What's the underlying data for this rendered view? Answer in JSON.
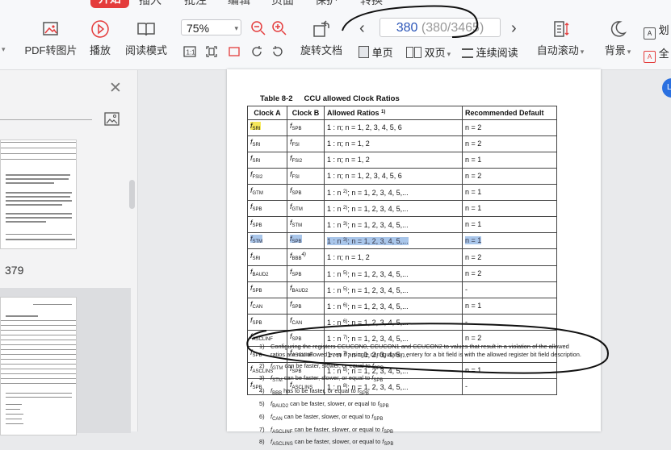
{
  "menu": {
    "tabs": [
      "开始",
      "插入",
      "批注",
      "编辑",
      "页面",
      "保护",
      "转换"
    ]
  },
  "toolbar": {
    "pdf_to_image": "PDF转图片",
    "play": "播放",
    "read_mode": "阅读模式",
    "zoom_value": "75%",
    "rotate": "旋转文档",
    "single_page": "单页",
    "double_page": "双页",
    "continuous": "连续阅读",
    "auto_scroll": "自动滚动",
    "background": "背景",
    "far_right_1": "划",
    "far_right_2": "全"
  },
  "page_nav": {
    "current": "380",
    "total_text": "(380/3465)"
  },
  "sidebar": {
    "thumb_page_label": "379"
  },
  "document": {
    "table_number": "Table 8-2",
    "table_title": "CCU allowed Clock Ratios",
    "headers": {
      "clock_a": "Clock A",
      "clock_b": "Clock B",
      "allowed": "Allowed Ratios",
      "allowed_sup": "1)",
      "recommended": "Recommended Default"
    },
    "rows": [
      {
        "a": "f",
        "as": "SRI",
        "b": "f",
        "bs": "SPB",
        "ratio": "1 : n; n = 1, 2, 3, 4, 5, 6",
        "def": "n = 2"
      },
      {
        "a": "f",
        "as": "SRI",
        "b": "f",
        "bs": "FSI",
        "ratio": "1 : n; n = 1, 2",
        "def": "n = 2"
      },
      {
        "a": "f",
        "as": "SRI",
        "b": "f",
        "bs": "FSI2",
        "ratio": "1 : n; n = 1, 2",
        "def": "n = 1"
      },
      {
        "a": "f",
        "as": "FSI2",
        "b": "f",
        "bs": "FSI",
        "ratio": "1 : n; n = 1, 2, 3, 4, 5, 6",
        "def": "n = 2"
      },
      {
        "a": "f",
        "as": "GTM",
        "b": "f",
        "bs": "SPB",
        "ratio": "1 : n 2); n = 1, 2, 3, 4, 5,...",
        "def": "n = 1"
      },
      {
        "a": "f",
        "as": "SPB",
        "b": "f",
        "bs": "GTM",
        "ratio": "1 : n 2); n = 1, 2, 3, 4, 5,...",
        "def": "n = 1"
      },
      {
        "a": "f",
        "as": "SPB",
        "b": "f",
        "bs": "STM",
        "ratio": "1 : n 3); n = 1, 2, 3, 4, 5,...",
        "def": "n = 1"
      },
      {
        "a": "f",
        "as": "STM",
        "b": "f",
        "bs": "SPB",
        "ratio": "1 : n 3); n = 1, 2, 3, 4, 5,...",
        "def": "n = 1"
      },
      {
        "a": "f",
        "as": "SRI",
        "b": "f",
        "bs": "BBB 4)",
        "ratio": "1 : n; n = 1, 2",
        "def": "n = 2"
      },
      {
        "a": "f",
        "as": "BAUD2",
        "b": "f",
        "bs": "SPB",
        "ratio": "1 : n 5); n = 1, 2, 3, 4, 5,...",
        "def": "n = 2"
      },
      {
        "a": "f",
        "as": "SPB",
        "b": "f",
        "bs": "BAUD2",
        "ratio": "1 : n 5); n = 1, 2, 3, 4, 5,...",
        "def": "-"
      },
      {
        "a": "f",
        "as": "CAN",
        "b": "f",
        "bs": "SPB",
        "ratio": "1 : n 6); n = 1, 2, 3, 4, 5,...",
        "def": "n = 1"
      },
      {
        "a": "f",
        "as": "SPB",
        "b": "f",
        "bs": "CAN",
        "ratio": "1 : n 6); n = 1, 2, 3, 4, 5,...",
        "def": "-"
      },
      {
        "a": "f",
        "as": "ASCLINF",
        "b": "f",
        "bs": "SPB",
        "ratio": "1 : n 7); n = 1, 2, 3, 4, 5,...",
        "def": "n = 2"
      },
      {
        "a": "f",
        "as": "SPB",
        "b": "f",
        "bs": "ASCLINF",
        "ratio": "1 : n 7); n = 1, 2, 3, 4, 5,...",
        "def": "-"
      },
      {
        "a": "f",
        "as": "ASCLINS",
        "b": "f",
        "bs": "SPB",
        "ratio": "1 : n 8); n = 1, 2, 3, 4, 5,...",
        "def": "n = 1"
      },
      {
        "a": "f",
        "as": "SPB",
        "b": "f",
        "bs": "ASCLINS",
        "ratio": "1 : n 8); n = 1, 2, 3, 4, 5,...",
        "def": "-"
      }
    ],
    "footnotes": [
      "Configuring the registers CCUCON0, CCUCON1 and CCUCON2 to values that result in a violation of the allowed ratios are not allowed even if a single configuration entery for a bit field is with the allowed register bit field description.",
      "can be faster, slower, or equal to",
      "can be faster, slower, or equal to",
      "has to be faster, or equal to",
      "can be faster, slower, or equal to",
      "can be faster, slower, or equal to",
      "can be faster, slower, or equal to",
      "can be faster, slower, or equal to"
    ],
    "footnote_subs": [
      "",
      "GTM",
      "STM",
      "BBB",
      "BAUD2",
      "CAN",
      "ASCLINF",
      "ASCLINS"
    ],
    "footnote_targets": [
      "",
      "SPB",
      "SPB",
      "SPB",
      "SPB",
      "SPB",
      "SPB",
      "SPB"
    ]
  },
  "colors": {
    "accent_red": "#e43c3c",
    "page_number_blue": "#2b55b8",
    "selection_blue": "#a9c6ea",
    "highlight_yellow": "#f6e85a"
  }
}
